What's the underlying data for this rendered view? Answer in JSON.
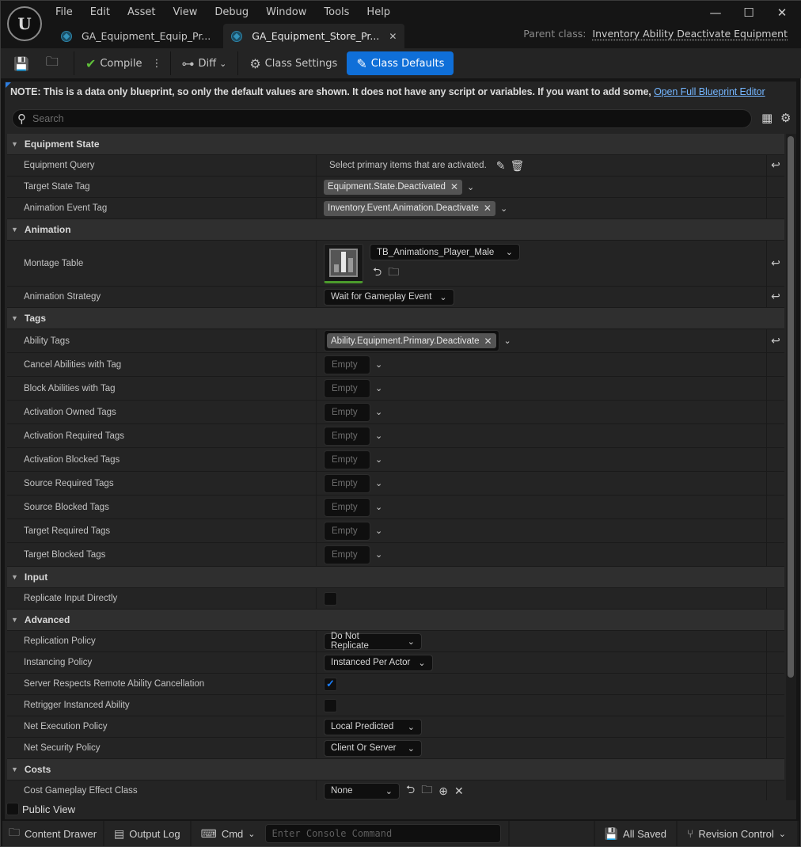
{
  "window": {
    "menu": [
      "File",
      "Edit",
      "Asset",
      "View",
      "Debug",
      "Window",
      "Tools",
      "Help"
    ],
    "controls": {
      "minimize": "—",
      "maximize": "☐",
      "close": "✕"
    },
    "tabs": [
      {
        "label": "GA_Equipment_Equip_Pr...",
        "active": false
      },
      {
        "label": "GA_Equipment_Store_Pr...",
        "active": true
      }
    ],
    "parent_class_label": "Parent class:",
    "parent_class_value": "Inventory Ability Deactivate Equipment"
  },
  "toolbar": {
    "compile": "Compile",
    "diff": "Diff",
    "class_settings": "Class Settings",
    "class_defaults": "Class Defaults",
    "accent": "#0f6fd8"
  },
  "note": {
    "text": "NOTE: This is a data only blueprint, so only the default values are shown.  It does not have any script or variables.  If you want to add some,",
    "link": "Open Full Blueprint Editor"
  },
  "search": {
    "placeholder": "Search",
    "value": ""
  },
  "categories": {
    "equipment_state": {
      "title": "Equipment State",
      "equipment_query": {
        "label": "Equipment Query",
        "value": "Select primary items that are activated."
      },
      "target_state_tag": {
        "label": "Target State Tag",
        "value": "Equipment.State.Deactivated"
      },
      "animation_event_tag": {
        "label": "Animation Event Tag",
        "value": "Inventory.Event.Animation.Deactivate"
      }
    },
    "animation": {
      "title": "Animation",
      "montage_table": {
        "label": "Montage Table",
        "value": "TB_Animations_Player_Male"
      },
      "animation_strategy": {
        "label": "Animation Strategy",
        "value": "Wait for Gameplay Event"
      }
    },
    "tags": {
      "title": "Tags",
      "ability_tags": {
        "label": "Ability Tags",
        "value": "Ability.Equipment.Primary.Deactivate"
      },
      "empty_label": "Empty",
      "empty_rows": [
        "Cancel Abilities with Tag",
        "Block Abilities with Tag",
        "Activation Owned Tags",
        "Activation Required Tags",
        "Activation Blocked Tags",
        "Source Required Tags",
        "Source Blocked Tags",
        "Target Required Tags",
        "Target Blocked Tags"
      ]
    },
    "input": {
      "title": "Input",
      "replicate_input_directly": {
        "label": "Replicate Input Directly",
        "checked": false
      }
    },
    "advanced": {
      "title": "Advanced",
      "replication_policy": {
        "label": "Replication Policy",
        "value": "Do Not Replicate"
      },
      "instancing_policy": {
        "label": "Instancing Policy",
        "value": "Instanced Per Actor"
      },
      "server_respects": {
        "label": "Server Respects Remote Ability Cancellation",
        "checked": true
      },
      "retrigger": {
        "label": "Retrigger Instanced Ability",
        "checked": false
      },
      "net_execution_policy": {
        "label": "Net Execution Policy",
        "value": "Local Predicted"
      },
      "net_security_policy": {
        "label": "Net Security Policy",
        "value": "Client Or Server"
      }
    },
    "costs": {
      "title": "Costs",
      "cost_ge_class": {
        "label": "Cost Gameplay Effect Class",
        "value": "None"
      }
    }
  },
  "public_view": {
    "label": "Public View",
    "checked": false
  },
  "statusbar": {
    "content_drawer": "Content Drawer",
    "output_log": "Output Log",
    "cmd": "Cmd",
    "console_placeholder": "Enter Console Command",
    "all_saved": "All Saved",
    "revision_control": "Revision Control"
  }
}
